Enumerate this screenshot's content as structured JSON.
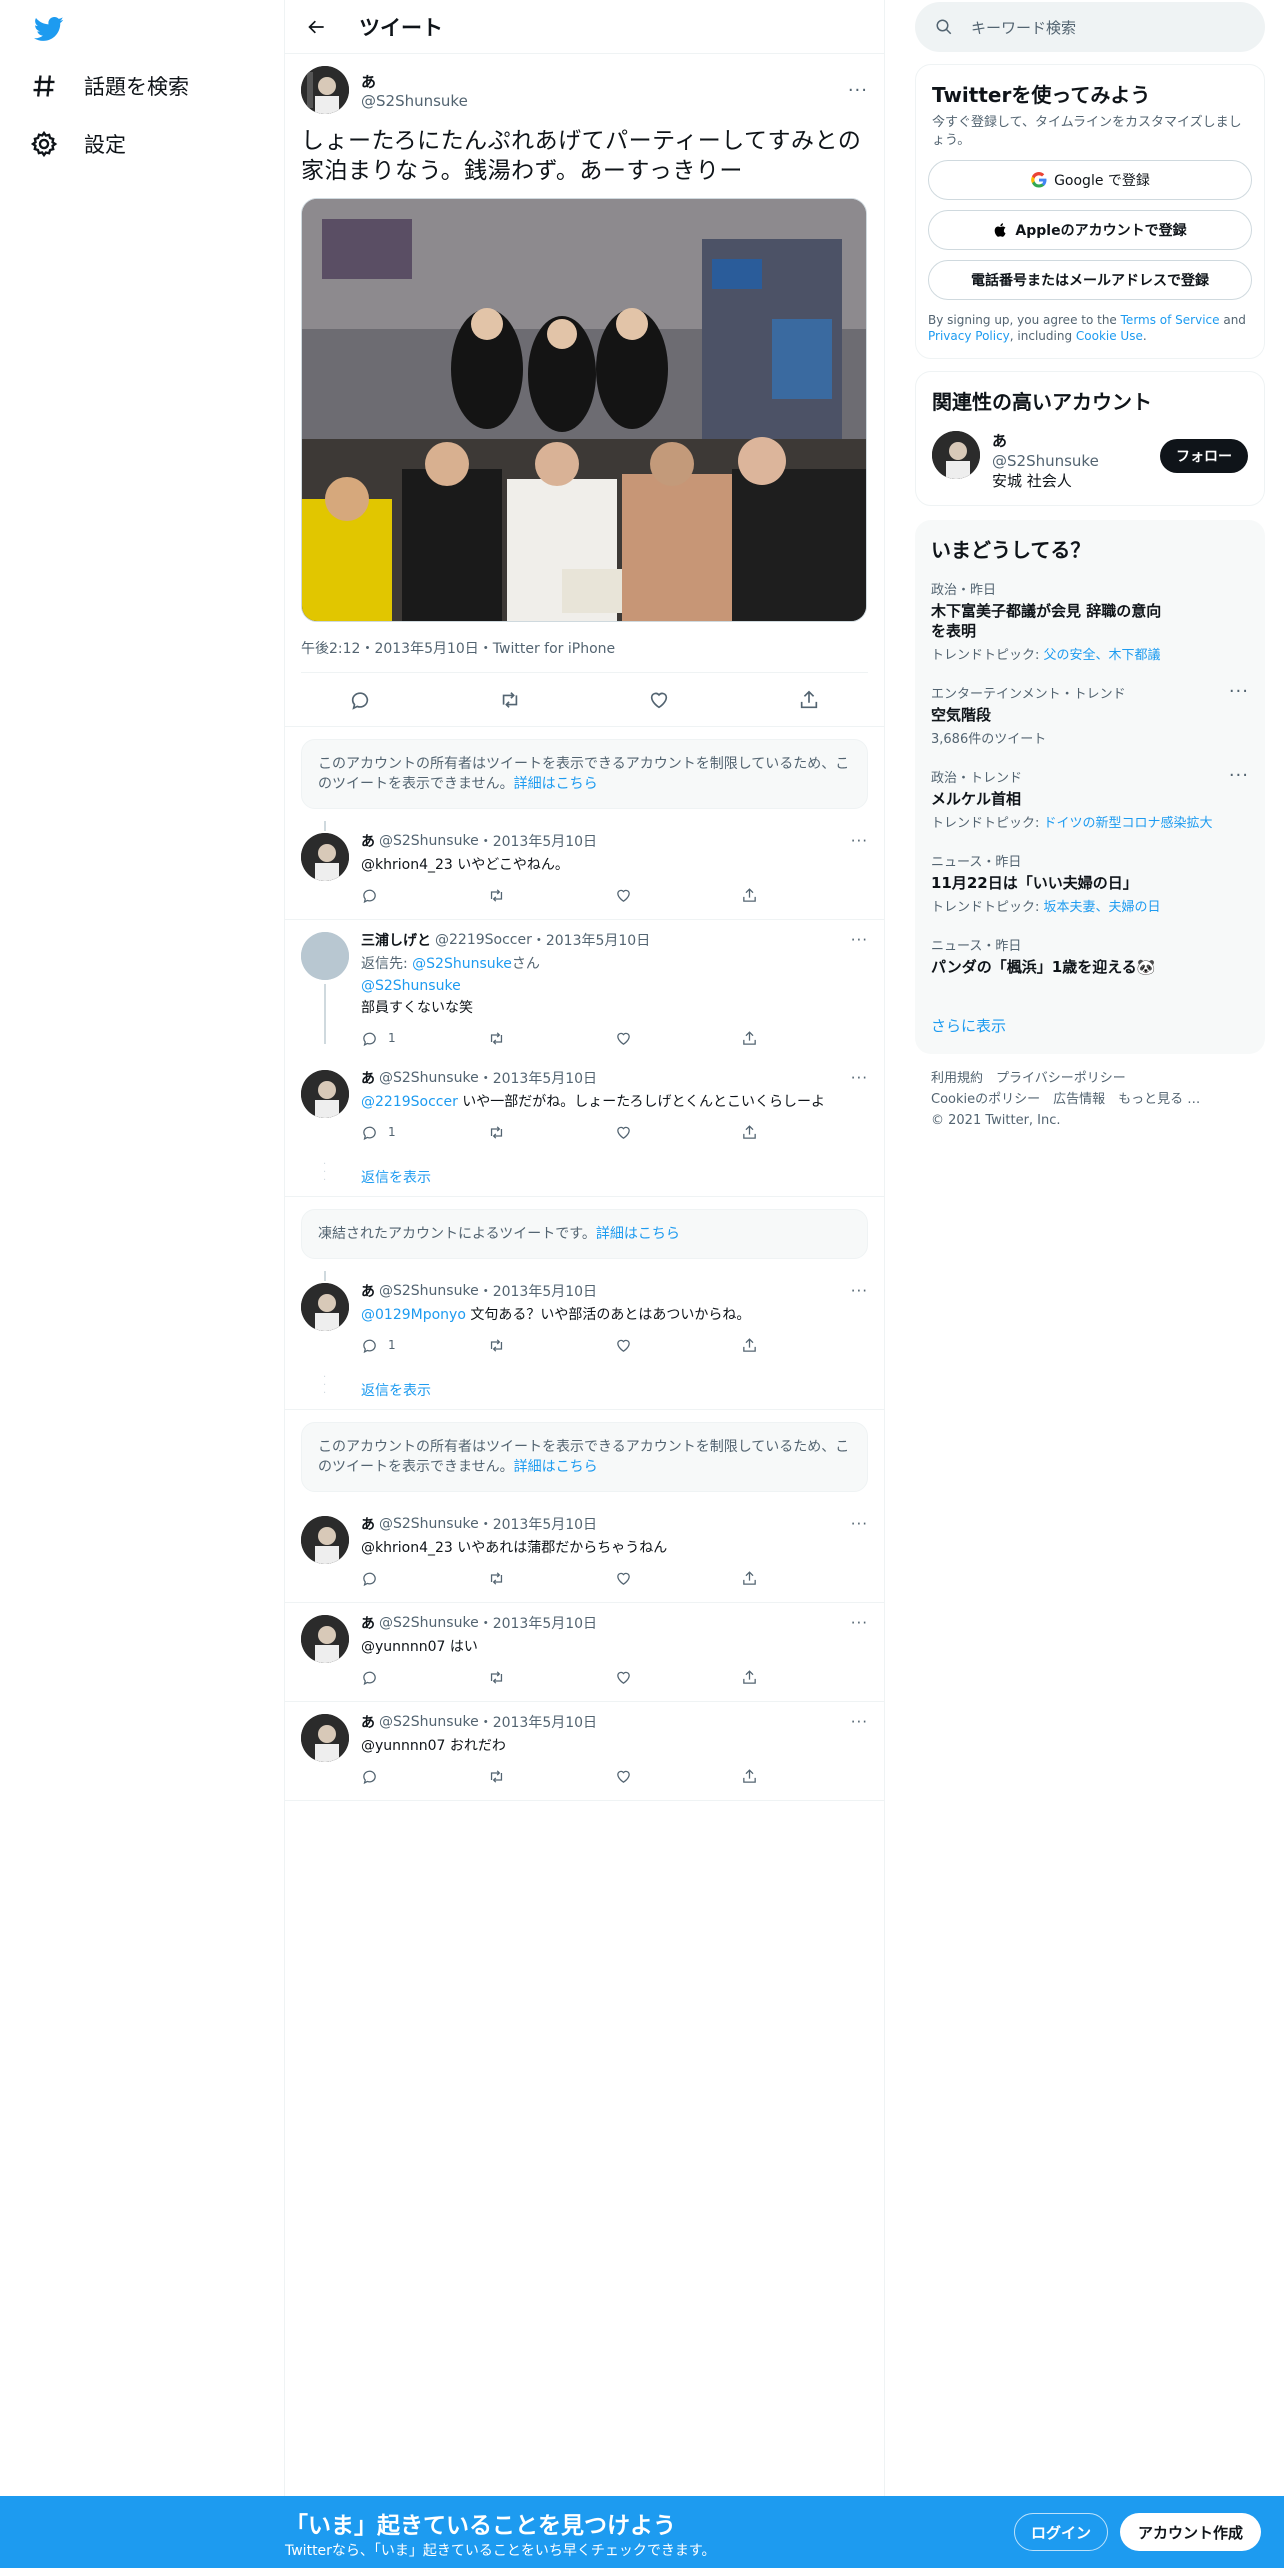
{
  "nav": {
    "explore_label": "話題を検索",
    "settings_label": "設定"
  },
  "header": {
    "title": "ツイート"
  },
  "focal": {
    "name": "あ",
    "handle": "@S2Shunsuke",
    "text": "しょーたろにたんぷれあげてパーティーしてすみとの家泊まりなう。銭湯わず。あーすっきりー",
    "meta": "午後2:12・2013年5月10日・Twitter for iPhone"
  },
  "notice1": {
    "text": "このアカウントの所有者はツイートを表示できるアカウントを制限しているため、このツイートを表示できません。",
    "link": "詳細はこちら"
  },
  "notice2": {
    "text": "凍結されたアカウントによるツイートです。",
    "link": "詳細はこちら"
  },
  "notice3": {
    "text": "このアカウントの所有者はツイートを表示できるアカウントを制限しているため、このツイートを表示できません。",
    "link": "詳細はこちら"
  },
  "replies": [
    {
      "name": "あ",
      "handle": "@S2Shunsuke",
      "date": "・2013年5月10日",
      "mention": "@khrion4_23",
      "text": " いやどこやねん。",
      "reply_count": ""
    },
    {
      "name": "三浦しげと",
      "handle": "@2219Soccer",
      "date": "・2013年5月10日",
      "reply_to_prefix": "返信先: ",
      "reply_to": "@S2Shunsuke",
      "reply_to_suffix": "さん",
      "mention": "@S2Shunsuke",
      "text": "部員すくないな笑",
      "reply_count": "1"
    },
    {
      "name": "あ",
      "handle": "@S2Shunsuke",
      "date": "・2013年5月10日",
      "mention": "@2219Soccer",
      "text": " いや一部だがね。しょーたろしげとくんとこいくらしーよ",
      "reply_count": "1"
    },
    {
      "name": "あ",
      "handle": "@S2Shunsuke",
      "date": "・2013年5月10日",
      "mention": "@0129Mponyo",
      "text": " 文句ある？いや部活のあとはあついからね。",
      "reply_count": "1"
    },
    {
      "name": "あ",
      "handle": "@S2Shunsuke",
      "date": "・2013年5月10日",
      "mention": "",
      "text": "@khrion4_23 いやあれは蒲郡だからちゃうねん",
      "reply_count": ""
    },
    {
      "name": "あ",
      "handle": "@S2Shunsuke",
      "date": "・2013年5月10日",
      "mention": "",
      "text": "@yunnnn07 はい",
      "reply_count": ""
    },
    {
      "name": "あ",
      "handle": "@S2Shunsuke",
      "date": "・2013年5月10日",
      "mention": "",
      "text": "@yunnnn07 おれだわ",
      "reply_count": ""
    }
  ],
  "show_replies": "返信を表示",
  "search": {
    "placeholder": "キーワード検索"
  },
  "signup": {
    "title": "Twitterを使ってみよう",
    "subtitle": "今すぐ登録して、タイムラインをカスタマイズしましょう。",
    "google": "Google で登録",
    "apple": "Appleのアカウントで登録",
    "phone": "電話番号またはメールアドレスで登録",
    "legal_1": "By signing up, you agree to the ",
    "terms": "Terms of Service",
    "legal_2": " and ",
    "privacy": "Privacy Policy",
    "legal_3": ", including ",
    "cookie": "Cookie Use",
    "legal_4": "."
  },
  "related": {
    "title": "関連性の高いアカウント",
    "name": "あ",
    "handle": "@S2Shunsuke",
    "bio": "安城 社会人",
    "follow": "フォロー"
  },
  "trends": {
    "title": "いまどうしてる？",
    "items": [
      {
        "cat": "政治・昨日",
        "name": "木下富美子都議が会見 辞職の意向を表明",
        "sub_prefix": "トレンドトピック: ",
        "sub_link": "父の安全、木下都議",
        "has_more": false
      },
      {
        "cat": "エンターテインメント・トレンド",
        "name": "空気階段",
        "sub_prefix": "3,686件のツイート",
        "sub_link": "",
        "has_more": true
      },
      {
        "cat": "政治・トレンド",
        "name": "メルケル首相",
        "sub_prefix": "トレンドトピック: ",
        "sub_link": "ドイツの新型コロナ感染拡大",
        "has_more": true
      },
      {
        "cat": "ニュース・昨日",
        "name": "11月22日は「いい夫婦の日」",
        "sub_prefix": "トレンドトピック: ",
        "sub_link": "坂本夫妻、夫婦の日",
        "has_more": false
      },
      {
        "cat": "ニュース・昨日",
        "name": "パンダの「楓浜」1歳を迎える🐼",
        "sub_prefix": "",
        "sub_link": "",
        "has_more": false
      }
    ],
    "show_more": "さらに表示"
  },
  "footer": {
    "line1": "利用規約　プライバシーポリシー",
    "line2": "Cookieのポリシー　広告情報　もっと見る …",
    "line3": "© 2021 Twitter, Inc."
  },
  "bottom": {
    "title": "「いま」起きていることを見つけよう",
    "subtitle": "Twitterなら、「いま」起きていることをいち早くチェックできます。",
    "login": "ログイン",
    "signup": "アカウント作成"
  },
  "colors": {
    "accent": "#1d9bf0",
    "text": "#0f1419",
    "muted": "#536471"
  }
}
